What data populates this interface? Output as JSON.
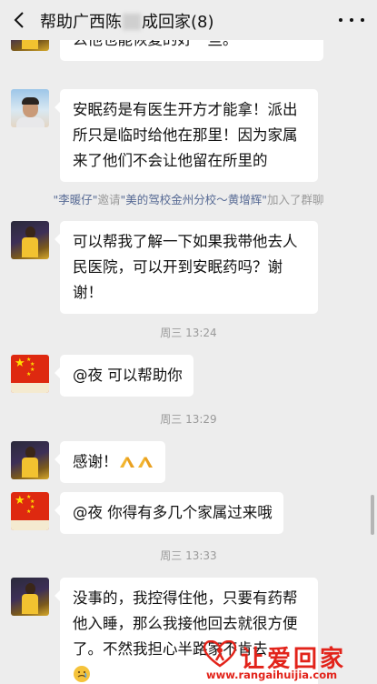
{
  "header": {
    "title_part1": "帮助广西陈",
    "title_part2": "成回家(8)"
  },
  "messages": [
    {
      "line1": "么他也能恢复的好一些。"
    },
    {
      "line1": "安眠药是有医生开方才能拿！派出",
      "line2": "所只是临时给他在那里！因为家属",
      "line3": "来了他们不会让他留在所里的"
    },
    {
      "line1": "可以帮我了解一下如果我带他去人",
      "line2": "民医院，可以开到安眠药吗？谢",
      "line3": "谢！"
    },
    {
      "line1": "@夜  可以帮助你"
    },
    {
      "line1": "感谢！"
    },
    {
      "line1": "@夜  你得有多几个家属过来哦"
    },
    {
      "line1": "没事的，我控得住他，只要有药帮",
      "line2": "他入睡，那么我接他回去就很方便",
      "line3": "了。不然我担心半路",
      "line3b": "家不肯去"
    }
  ],
  "system": {
    "inviter": "\"李暖仔\"",
    "verb": "邀请",
    "invitee": "\"美的驾校金州分校～黄增辉\"",
    "suffix": "加入了群聊"
  },
  "timestamps": [
    "周三 13:24",
    "周三 13:29",
    "周三 13:33"
  ],
  "watermark": {
    "title": "让爱回家",
    "url": "www.rangaihuijia.com"
  },
  "icons": {
    "back": "chevron-left-icon",
    "more": "more-dots-icon"
  },
  "colors": {
    "background": "#ededed",
    "bubble": "#ffffff",
    "system_name": "#586b95",
    "watermark": "#e2231a"
  }
}
